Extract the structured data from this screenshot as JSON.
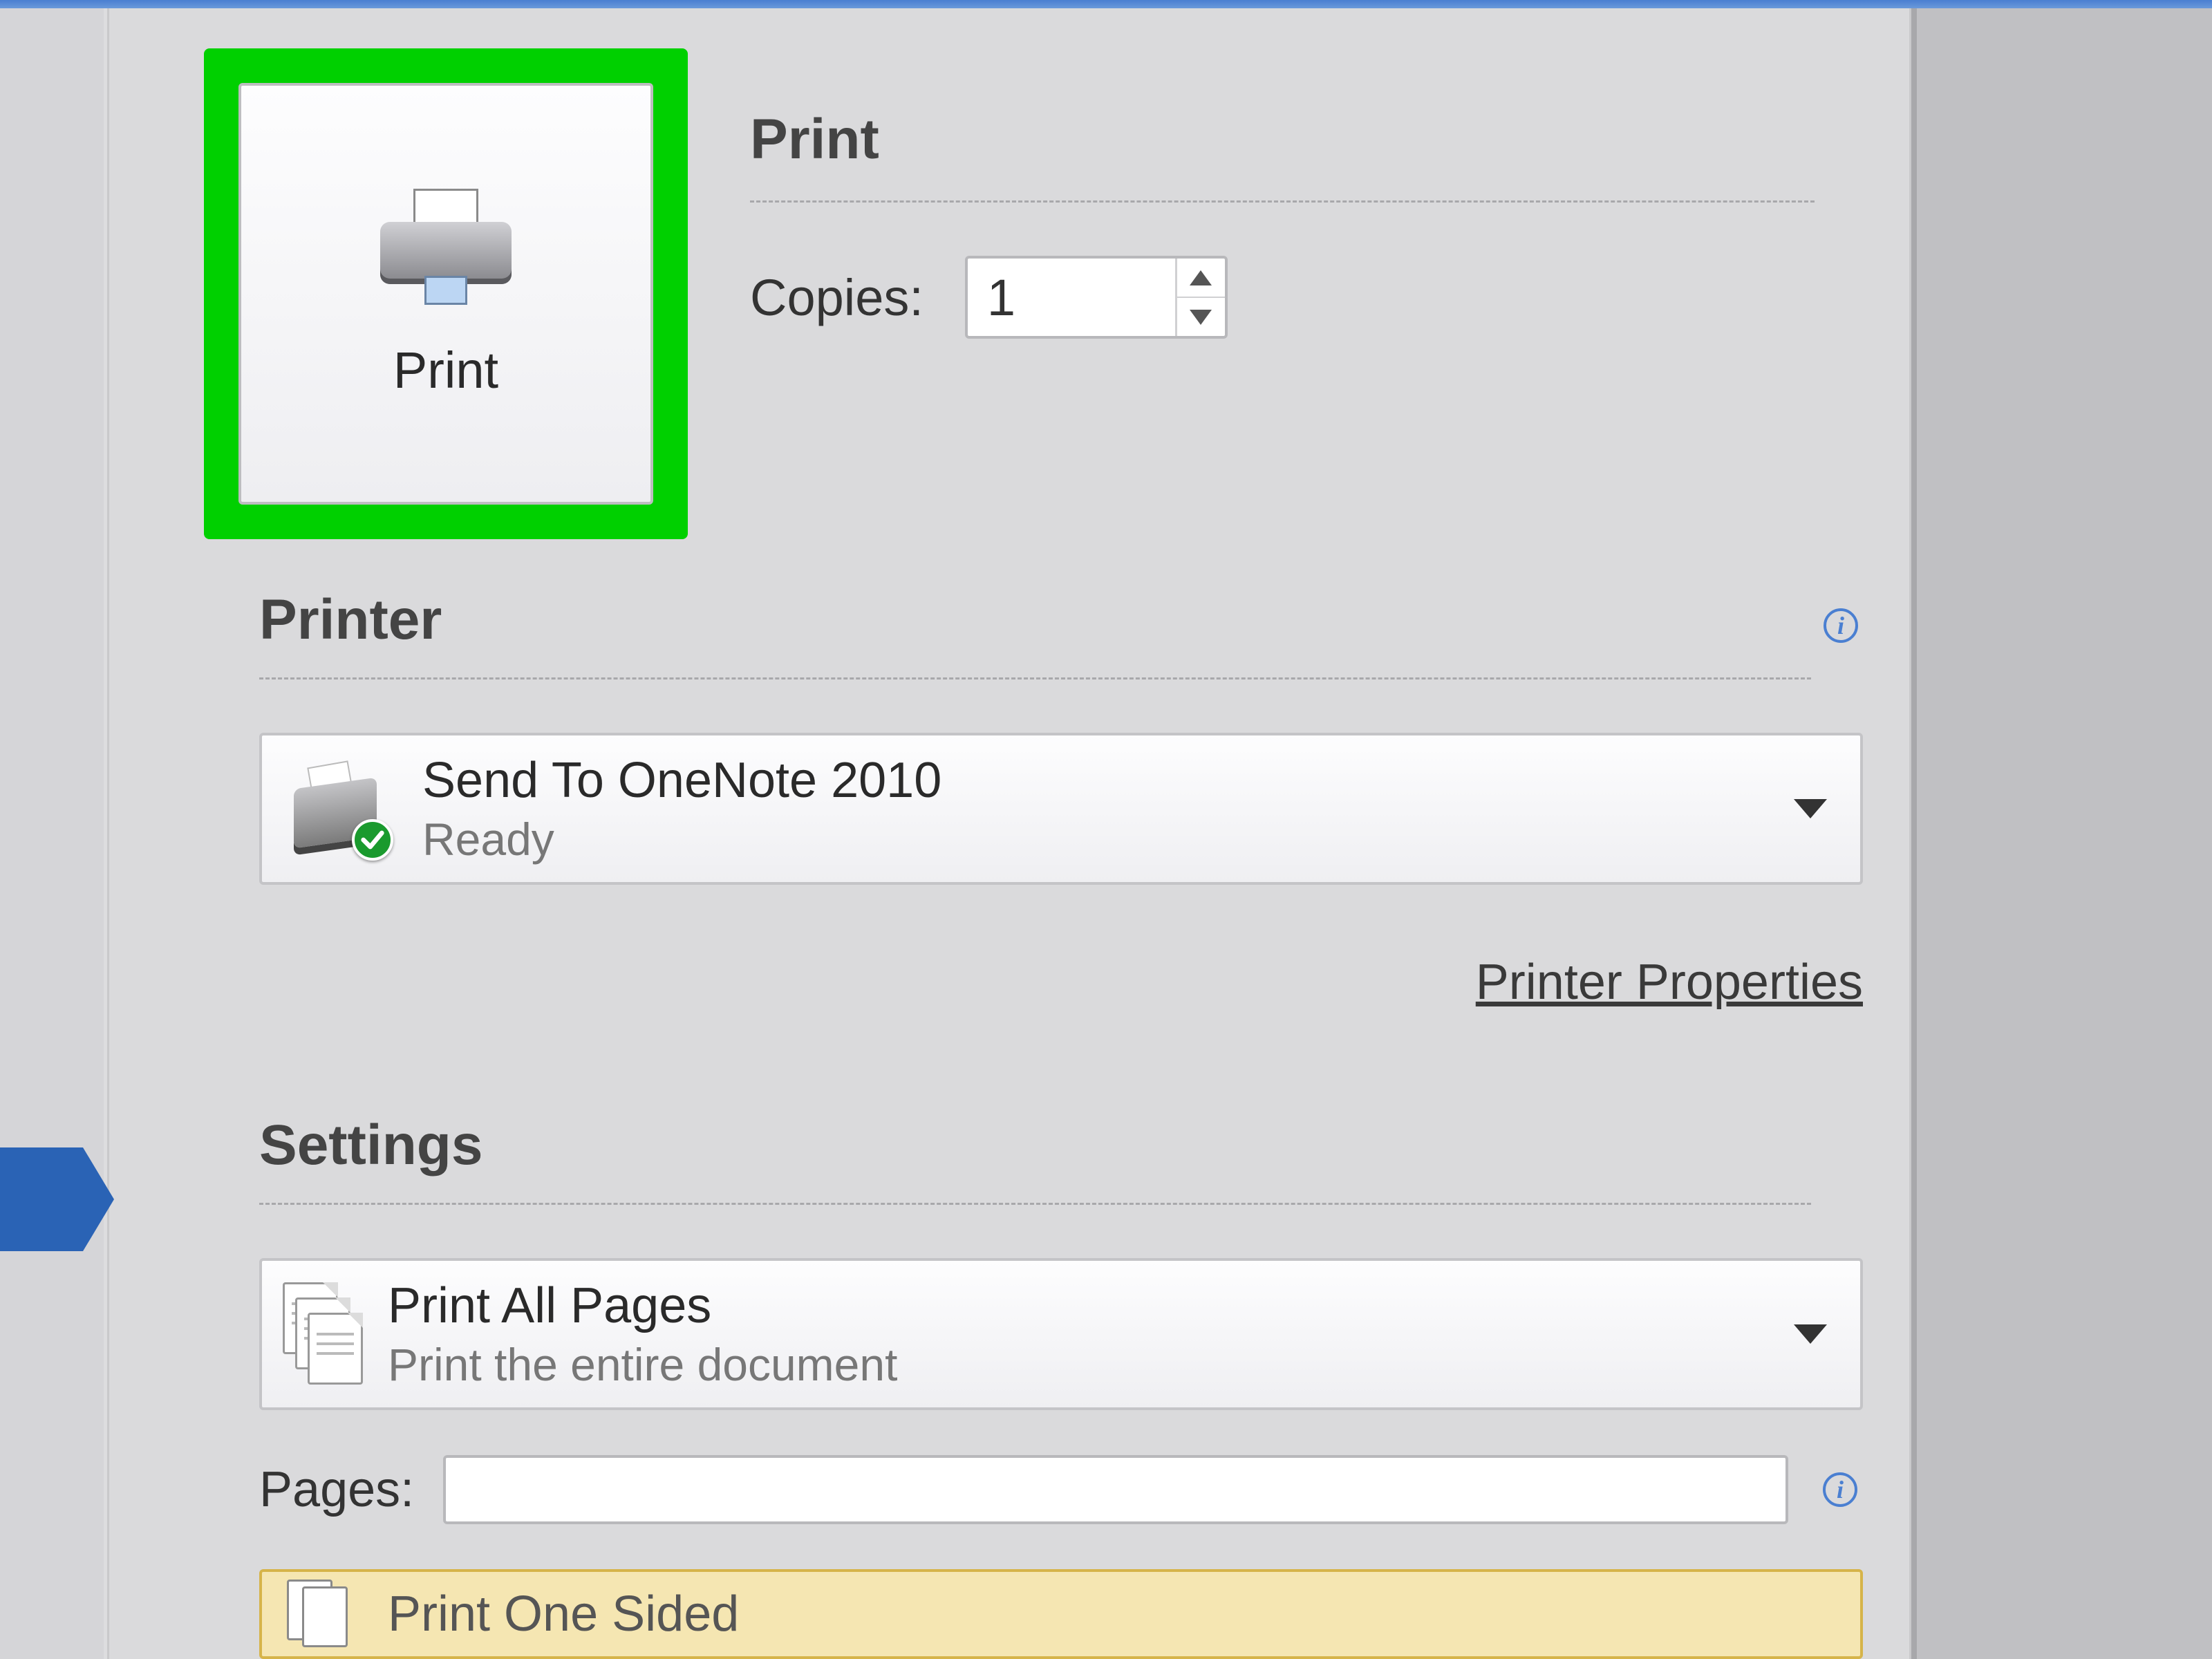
{
  "colors": {
    "highlight_green": "#00d000",
    "blue_accent": "#2a63b5"
  },
  "print_button": {
    "label": "Print"
  },
  "print_section": {
    "heading": "Print",
    "copies_label": "Copies:",
    "copies_value": "1"
  },
  "printer_section": {
    "heading": "Printer",
    "selected": {
      "name": "Send To OneNote 2010",
      "status": "Ready"
    },
    "properties_link": "Printer Properties"
  },
  "settings_section": {
    "heading": "Settings",
    "option": {
      "title": "Print All Pages",
      "subtitle": "Print the entire document"
    },
    "pages_label": "Pages:",
    "pages_value": "",
    "one_sided_label": "Print One Sided"
  }
}
